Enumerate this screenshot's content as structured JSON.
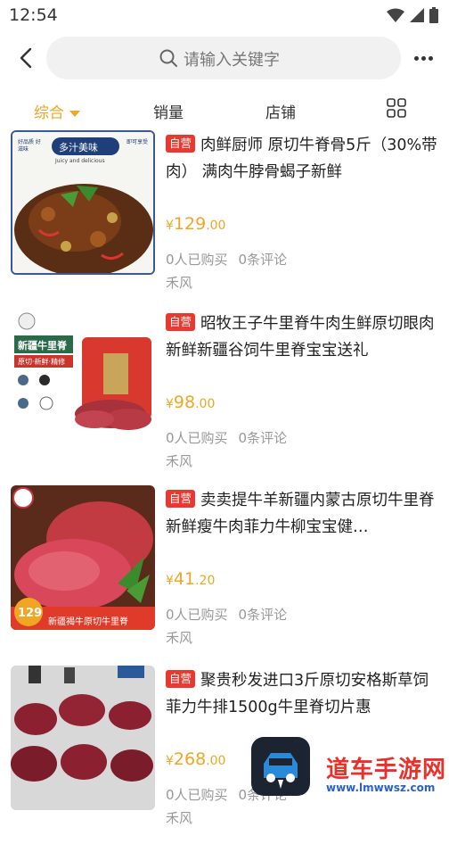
{
  "status_bar": {
    "time": "12:54"
  },
  "search": {
    "placeholder": "请输入关键字"
  },
  "tabs": [
    {
      "label": "综合",
      "active": true
    },
    {
      "label": "销量",
      "active": false
    },
    {
      "label": "店铺",
      "active": false
    }
  ],
  "badge_label": "自营",
  "currency": "¥",
  "products": [
    {
      "title": "肉鲜厨师 原切牛脊骨5斤（30%带肉） 满肉牛脖骨蝎子新鲜",
      "price_int": "129",
      "price_dec": ".00",
      "buyers": "0人已购买",
      "reviews": "0条评论",
      "shop": "禾风"
    },
    {
      "title": "昭牧王子牛里脊牛肉生鲜原切眼肉新鲜新疆谷饲牛里脊宝宝送礼",
      "price_int": "98",
      "price_dec": ".00",
      "buyers": "0人已购买",
      "reviews": "0条评论",
      "shop": "禾风"
    },
    {
      "title": "卖卖提牛羊新疆内蒙古原切牛里脊新鲜瘦牛肉菲力牛柳宝宝健…",
      "price_int": "41",
      "price_dec": ".20",
      "buyers": "0人已购买",
      "reviews": "0条评论",
      "shop": "禾风"
    },
    {
      "title": "聚贵秒发进口3斤原切安格斯草饲菲力牛排1500g牛里脊切片惠",
      "price_int": "268",
      "price_dec": ".00",
      "buyers": "0人已购买",
      "reviews": "0条评论",
      "shop": "禾风"
    }
  ],
  "thumb_texts": {
    "p1_banner": "多汁美味",
    "p1_sub": "Juicy and delicious",
    "p1_left": "好品质 好滋味",
    "p1_right": "即可享受",
    "p2_label": "新疆牛里脊",
    "p2_sub": "原切·新鲜·精修",
    "p3_price": "129",
    "p3_label": "新疆褐牛原切牛里脊"
  },
  "watermark": {
    "title": "道车手游网",
    "url": "www.lmwwsz.com"
  }
}
